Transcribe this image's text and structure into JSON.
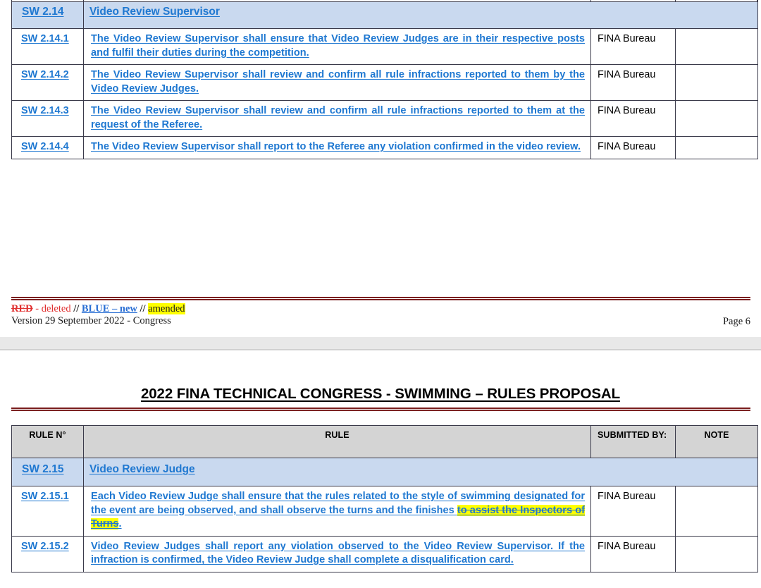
{
  "document": {
    "title": "2022 FINA TECHNICAL CONGRESS - SWIMMING – RULES PROPOSAL"
  },
  "colors": {
    "link_blue": "#1f78d1",
    "section_row_bg": "#c9d9ef",
    "header_row_bg": "#d4d4d4",
    "rule_line_maroon": "#7b2020",
    "highlight_yellow": "#ffff00",
    "deleted_red": "#e03030"
  },
  "table_headers": {
    "rule_no": "RULE N°",
    "rule": "RULE",
    "submitted_by": "SUBMITTED BY:",
    "note": "NOTE"
  },
  "page1": {
    "section": {
      "rule_id": "SW 2.14",
      "title": "Video Review Supervisor"
    },
    "rows": [
      {
        "rule_id": "SW 2.14.1",
        "text": "The Video Review Supervisor shall ensure that Video Review Judges are in their respective posts and fulfil their duties during the competition.",
        "submitted_by": "FINA Bureau",
        "note": ""
      },
      {
        "rule_id": "SW 2.14.2",
        "text": "The Video Review Supervisor shall review and confirm all rule infractions reported to them by the Video Review Judges.",
        "submitted_by": "FINA Bureau",
        "note": ""
      },
      {
        "rule_id": "SW 2.14.3",
        "text": "The Video Review Supervisor shall review and confirm all rule infractions reported to them at the request of the Referee.",
        "submitted_by": "FINA Bureau",
        "note": ""
      },
      {
        "rule_id": "SW 2.14.4",
        "text": "The Video Review Supervisor shall report to the Referee any violation confirmed in the video review.",
        "submitted_by": "FINA Bureau",
        "note": ""
      }
    ],
    "footer": {
      "legend_red": "RED",
      "legend_deleted": " - deleted ",
      "legend_sep1": "// ",
      "legend_blue": "BLUE – new",
      "legend_sep2": " // ",
      "legend_amended": "amended",
      "version": "Version 29 September 2022 - Congress",
      "page_number": "Page 6"
    }
  },
  "page2": {
    "section": {
      "rule_id": "SW 2.15",
      "title": "Video Review Judge"
    },
    "rows": [
      {
        "rule_id": "SW 2.15.1",
        "text_before": "Each Video Review Judge shall ensure that the rules related to the style of swimming designated for the event are being observed, and shall observe the turns and the finishes ",
        "text_struck": "to assist the Inspectors of Turns",
        "text_after": ".",
        "submitted_by": "FINA Bureau",
        "note": ""
      },
      {
        "rule_id": "SW 2.15.2",
        "text": "Video Review Judges shall report any violation observed to the Video Review Supervisor. If the infraction is confirmed, the Video Review Judge shall complete a disqualification card.",
        "submitted_by": "FINA Bureau",
        "note": ""
      }
    ]
  }
}
